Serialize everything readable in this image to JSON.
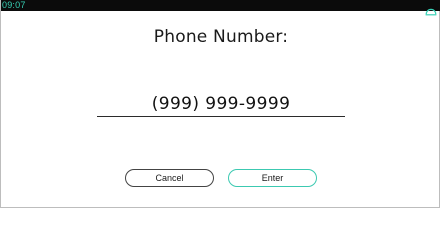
{
  "status_bar": {
    "time": "09:07",
    "home_icon": "home-icon",
    "accent_color": "#37d1b6"
  },
  "screen": {
    "title": "Phone Number:",
    "phone_value": "(999) 999-9999"
  },
  "buttons": {
    "cancel_label": "Cancel",
    "enter_label": "Enter",
    "enter_border_color": "#3cc9b1"
  }
}
